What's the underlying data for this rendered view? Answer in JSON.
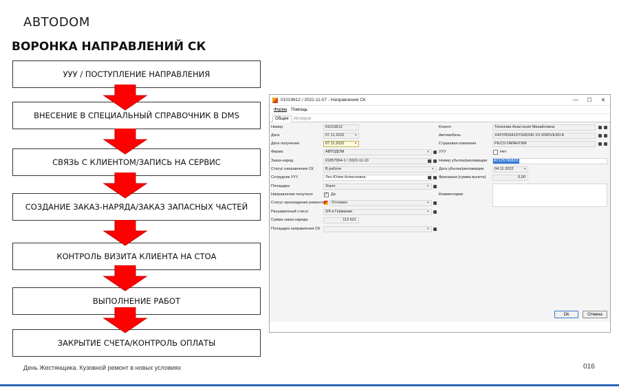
{
  "slide": {
    "logo": "ABTODOM",
    "title": "ВОРОНКА НАПРАВЛЕНИЙ СК",
    "footer": "День Жестянщика. Кузовной ремонт в новых условиях",
    "page_number": "016"
  },
  "funnel": {
    "steps": [
      "УУУ / ПОСТУПЛЕНИЕ НАПРАВЛЕНИЯ",
      "ВНЕСЕНИЕ В СПЕЦИАЛЬНЫЙ СПРАВОЧНИК В DMS",
      "СВЯЗЬ С КЛИЕНТОМ/ЗАПИСЬ НА СЕРВИС",
      "СОЗДАНИЕ ЗАКАЗ-НАРЯДА/ЗАКАЗ  ЗАПАСНЫХ ЧАСТЕЙ",
      "КОНТРОЛЬ ВИЗИТА КЛИЕНТА НА СТОА",
      "ВЫПОЛНЕНИЕ РАБОТ",
      "ЗАКРЫТИЕ СЧЕТА/КОНТРОЛЬ  ОПЛАТЫ"
    ],
    "arrow_color": "#ff0000"
  },
  "window": {
    "title": "01019612 / 2022-11-07 - Направления СК",
    "controls": {
      "minimize": "—",
      "maximize": "☐",
      "close": "✕"
    },
    "menu": [
      "Форма",
      "Помощь"
    ],
    "tabs": [
      "Общие",
      "История"
    ],
    "left_fields": [
      {
        "label": "Номер",
        "value": "01019612"
      },
      {
        "label": "Дата",
        "value": "07.11.2022"
      },
      {
        "label": "Дата получения",
        "value": "07.11.2022"
      },
      {
        "label": "Фирма",
        "value": "АВТОДОМ"
      },
      {
        "label": "Заказ-наряд",
        "value": "01857964-1 / 2022-11-10"
      },
      {
        "label": "Статус направления СК",
        "value": "В работе"
      },
      {
        "label": "Сотрудник УУУ",
        "value": "Лен Юлия Алексеевна"
      },
      {
        "label": "Площадка",
        "value": "Зорге"
      },
      {
        "label": "Направление получено",
        "value": "Да"
      },
      {
        "label": "Статус прохождения ремонта",
        "value": "Отложен"
      },
      {
        "label": "Расширенный статус",
        "value": "3/4 в Германии"
      },
      {
        "label": "Сумма заказ-наряда",
        "value": "113 921"
      },
      {
        "label": "Площадка направления СК",
        "value": ""
      }
    ],
    "right_fields": [
      {
        "label": "Клиент",
        "value": "Тихонова Анастасия Михайловна"
      },
      {
        "label": "Автомобиль",
        "value": "X4XYR59410YG00240 X3 XDRIVE30I A"
      },
      {
        "label": "Страховая компания",
        "value": "РЕСО-ГАРАНТИЯ"
      },
      {
        "label": "УУУ",
        "value": "Нет"
      },
      {
        "label": "Номер убытка/рекламации",
        "value": "AT12579682/1"
      },
      {
        "label": "Дата убытка/рекламации",
        "value": "04.11.2022"
      },
      {
        "label": "Франшиза (сумма вычета)",
        "value": "0,00"
      },
      {
        "label": "Комментарии",
        "value": ""
      }
    ],
    "buttons": {
      "ok": "Ok",
      "cancel": "Отмена"
    }
  }
}
